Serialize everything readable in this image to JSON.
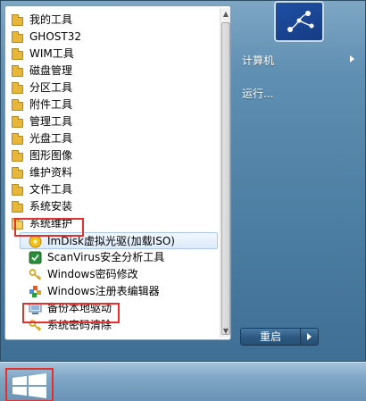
{
  "start_menu": {
    "programs": [
      {
        "label": "我的工具",
        "icon": "folder-icon",
        "level": 0
      },
      {
        "label": "GHOST32",
        "icon": "folder-icon",
        "level": 0
      },
      {
        "label": "WIM工具",
        "icon": "folder-icon",
        "level": 0
      },
      {
        "label": "磁盘管理",
        "icon": "folder-icon",
        "level": 0
      },
      {
        "label": "分区工具",
        "icon": "folder-icon",
        "level": 0
      },
      {
        "label": "附件工具",
        "icon": "folder-icon",
        "level": 0
      },
      {
        "label": "管理工具",
        "icon": "folder-icon",
        "level": 0
      },
      {
        "label": "光盘工具",
        "icon": "folder-icon",
        "level": 0
      },
      {
        "label": "图形图像",
        "icon": "folder-icon",
        "level": 0
      },
      {
        "label": "维护资料",
        "icon": "folder-icon",
        "level": 0
      },
      {
        "label": "文件工具",
        "icon": "folder-icon",
        "level": 0
      },
      {
        "label": "系统安装",
        "icon": "folder-icon",
        "level": 0
      },
      {
        "label": "系统维护",
        "icon": "folder-open-icon",
        "level": 0
      },
      {
        "label": "ImDisk虚拟光驱(加载ISO)",
        "icon": "imdisk-icon",
        "level": 1
      },
      {
        "label": "ScanVirus安全分析工具",
        "icon": "scanvirus-icon",
        "level": 1
      },
      {
        "label": "Windows密码修改",
        "icon": "key-icon",
        "level": 1
      },
      {
        "label": "Windows注册表编辑器",
        "icon": "regedit-icon",
        "level": 1
      },
      {
        "label": "备份本地驱动",
        "icon": "driver-backup-icon",
        "level": 1
      },
      {
        "label": "系统密码清除",
        "icon": "key-icon",
        "level": 1
      }
    ],
    "right_pane": {
      "computer": "计算机",
      "run": "运行..."
    },
    "shutdown_label": "重启"
  },
  "colors": {
    "highlight_box": "#e53030",
    "folder": "#e8b73a",
    "selection": "#dcebfc"
  }
}
